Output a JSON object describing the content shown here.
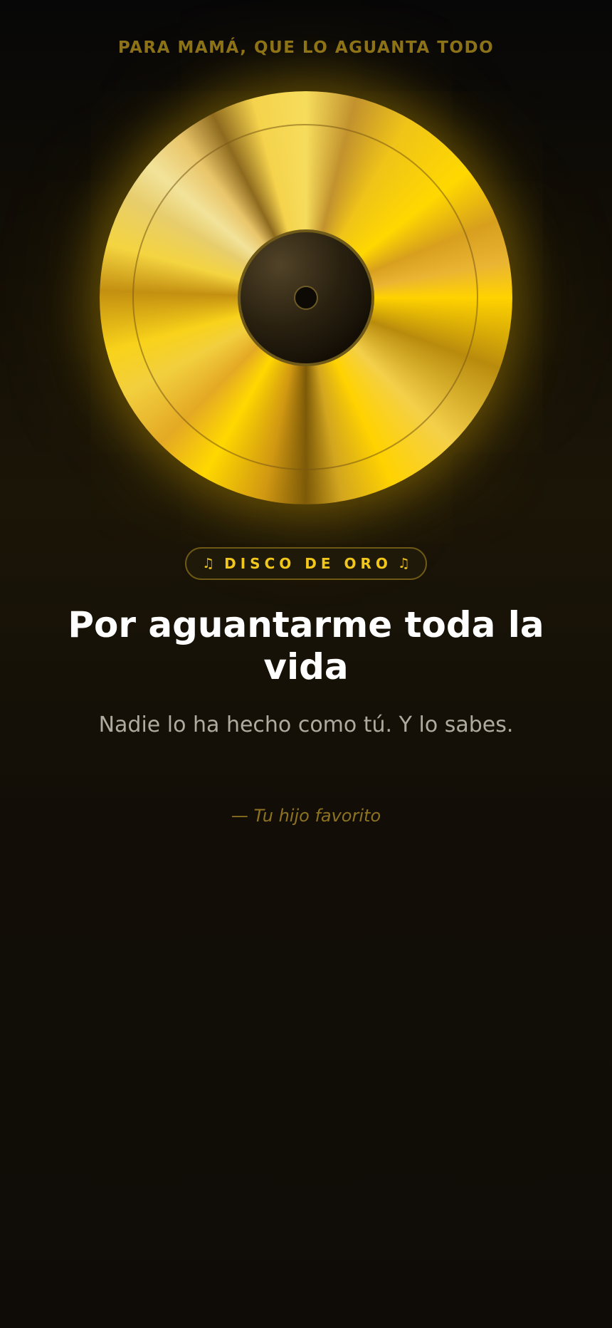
{
  "dedication": "PARA MAMÁ, QUE LO AGUANTA TODO",
  "badge": {
    "icon_left": "music-note-icon",
    "icon_right": "music-note-icon",
    "glyph": "♫",
    "text": "DISCO DE ORO"
  },
  "headline": "Por aguantarme toda la vida",
  "subtitle": "Nadie lo ha hecho como tú. Y lo sabes.",
  "signature": "— Tu hijo favorito",
  "colors": {
    "gold": "#f2c71b",
    "background": "#120e07",
    "muted_gold": "#8c7218",
    "text_muted": "#b0ab9f"
  }
}
